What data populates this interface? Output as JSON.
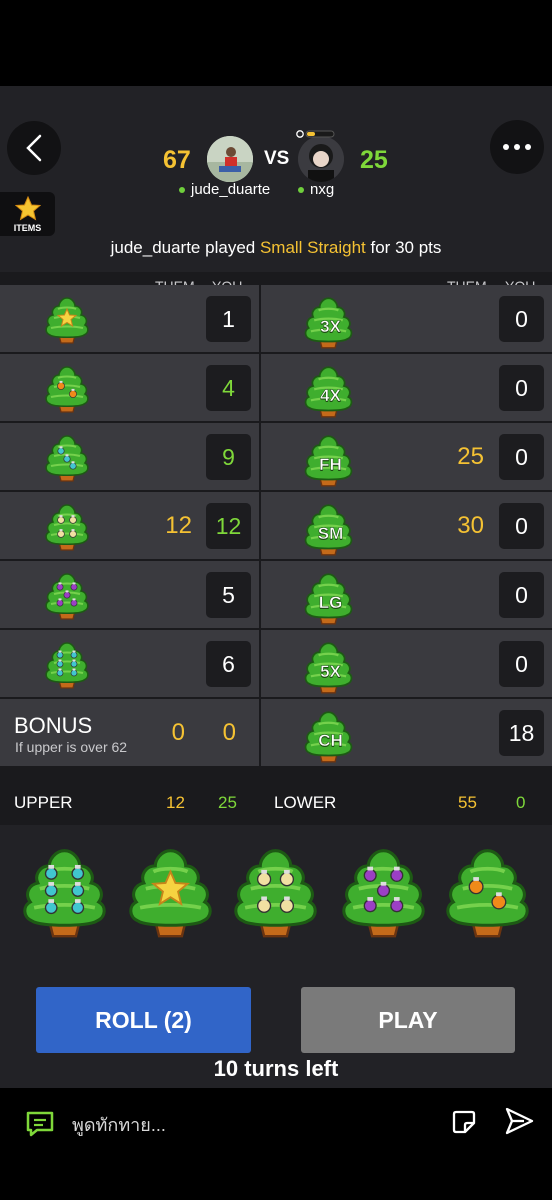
{
  "header": {
    "left_player": {
      "name": "jude_duarte",
      "score": "67"
    },
    "right_player": {
      "name": "nxg",
      "score": "25"
    },
    "vs_label": "VS",
    "items_label": "ITEMS"
  },
  "last_play": {
    "player": "jude_duarte",
    "verb": " played ",
    "category": "Small Straight",
    "suffix": " for 30 pts"
  },
  "table": {
    "upper_headers": {
      "them": "THEM",
      "you": "YOU"
    },
    "lower_headers": {
      "them": "THEM",
      "you": "YOU"
    },
    "upper_rows": [
      {
        "icon": "tree-star-icon",
        "them": "",
        "you": "1"
      },
      {
        "icon": "tree-orange-ornaments-2-icon",
        "them": "",
        "you": "4"
      },
      {
        "icon": "tree-teal-ornaments-3-icon",
        "them": "",
        "you": "9"
      },
      {
        "icon": "tree-cream-ornaments-4-icon",
        "them": "12",
        "you": "12"
      },
      {
        "icon": "tree-purple-ornaments-5-icon",
        "them": "",
        "you": "5"
      },
      {
        "icon": "tree-teal-ornaments-6-icon",
        "them": "",
        "you": "6"
      }
    ],
    "lower_rows": [
      {
        "label": "3X",
        "them": "",
        "you": "0"
      },
      {
        "label": "4X",
        "them": "",
        "you": "0"
      },
      {
        "label": "FH",
        "them": "25",
        "you": "0"
      },
      {
        "label": "SM",
        "them": "30",
        "you": "0"
      },
      {
        "label": "LG",
        "them": "",
        "you": "0"
      },
      {
        "label": "5X",
        "them": "",
        "you": "0"
      },
      {
        "label": "CH",
        "them": "",
        "you": "18"
      }
    ],
    "bonus": {
      "title": "BONUS",
      "subtitle": "If upper is over 62",
      "them": "0",
      "you": "0"
    },
    "totals": {
      "upper_label": "UPPER",
      "upper_them": "12",
      "upper_you": "25",
      "lower_label": "LOWER",
      "lower_them": "55",
      "lower_you": "0"
    }
  },
  "dice": [
    {
      "name": "die-teal-6",
      "value": 6,
      "color": "#41c6cf"
    },
    {
      "name": "die-star-1",
      "value": 1,
      "color": "#f6d341"
    },
    {
      "name": "die-cream-4",
      "value": 4,
      "color": "#f1e0a2"
    },
    {
      "name": "die-purple-5",
      "value": 5,
      "color": "#9b3fc4"
    },
    {
      "name": "die-orange-2",
      "value": 2,
      "color": "#f08a1a"
    }
  ],
  "buttons": {
    "roll": "ROLL (2)",
    "play": "PLAY"
  },
  "turns_left": "10 turns left",
  "chat": {
    "placeholder": "พูดทักทาย..."
  },
  "colors": {
    "them": "#f5c233",
    "you": "#7fd83a",
    "roll": "#3165c8",
    "play": "#7a7a7a"
  }
}
